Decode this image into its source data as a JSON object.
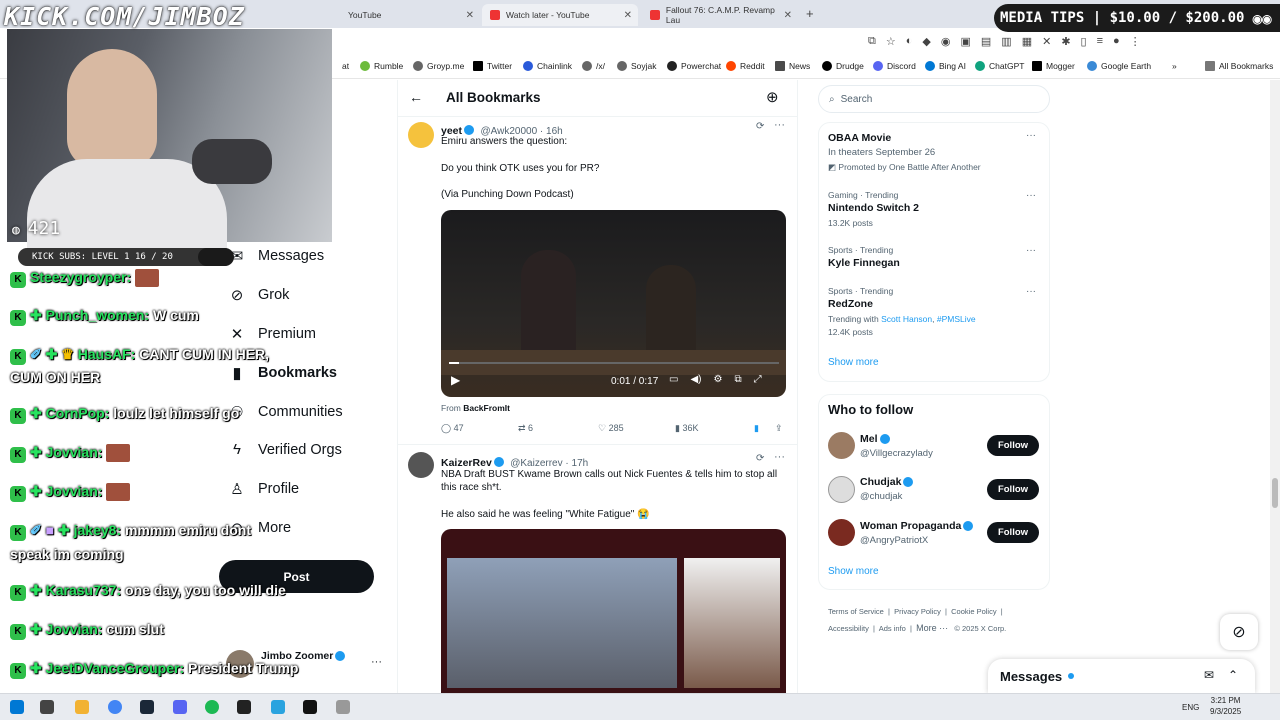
{
  "overlay": {
    "channel": "KICK.COM/JIMBOZ",
    "media_tips": "MEDIA TIPS | $10.00 / $200.00",
    "viewers": "421",
    "subs": "KICK SUBS: LEVEL 1 16 / 20"
  },
  "tabs": [
    {
      "label": "YouTube"
    },
    {
      "label": "Watch later - YouTube"
    },
    {
      "label": "Fallout 76: C.A.M.P. Revamp Lau"
    }
  ],
  "bookmarks": [
    "Rumble",
    "Groyp.me",
    "Twitter",
    "Chainlink",
    "/x/",
    "Soyjak",
    "Powerchat",
    "Reddit",
    "News",
    "Drudge",
    "Discord",
    "Bing AI",
    "ChatGPT",
    "Mogger",
    "Google Earth",
    "All Bookmarks"
  ],
  "chat": [
    {
      "user": "Steezygroyper:",
      "msg": ""
    },
    {
      "user": "Punch_women:",
      "msg": "W cum"
    },
    {
      "user": "HausAF:",
      "msg": "CANT CUM IN HER,"
    },
    {
      "user": "",
      "msg": "CUM ON HER"
    },
    {
      "user": "CornPop:",
      "msg": "loulz let himself go"
    },
    {
      "user": "Jovvian:",
      "msg": ""
    },
    {
      "user": "Jovvian:",
      "msg": ""
    },
    {
      "user": "jakey8:",
      "msg": "mmmm emiru dont"
    },
    {
      "user": "",
      "msg": "speak im coming"
    },
    {
      "user": "Karasu737:",
      "msg": "one day, you too will die"
    },
    {
      "user": "Jovvian:",
      "msg": "cum slut"
    },
    {
      "user": "JeetDVanceGrouper:",
      "msg": "President Trump"
    }
  ],
  "nav": {
    "messages": "Messages",
    "grok": "Grok",
    "premium": "Premium",
    "bookmarks": "Bookmarks",
    "communities": "Communities",
    "verified": "Verified Orgs",
    "profile": "Profile",
    "more": "More",
    "post": "Post",
    "account_name": "Jimbo Zoomer"
  },
  "feed": {
    "title": "All Bookmarks",
    "t1": {
      "name": "yeet",
      "handle": "@Awk20000",
      "time": "16h",
      "line1": "Emiru answers the question:",
      "line2": "Do you think OTK uses you for PR?",
      "line3": "(Via Punching Down Podcast)",
      "video_time": "0:01 / 0:17",
      "from_label": "From",
      "from": "BackFromIt",
      "replies": "47",
      "reposts": "6",
      "likes": "285",
      "views": "36K"
    },
    "t2": {
      "name": "KaizerRev",
      "handle": "@Kaizerrev",
      "time": "17h",
      "line1": "NBA Draft BUST Kwame Brown calls out Nick Fuentes & tells him to stop all",
      "line2": "this race sh*t.",
      "line3": "He also said he was feeling \"White Fatigue\" 😭"
    }
  },
  "side": {
    "search": "Search",
    "promo": {
      "name": "OBAA Movie",
      "sub": "In theaters September 26",
      "promo": "Promoted by One Battle After Another"
    },
    "trends": [
      {
        "cat": "Gaming · Trending",
        "name": "Nintendo Switch 2",
        "count": "13.2K posts"
      },
      {
        "cat": "Sports · Trending",
        "name": "Kyle Finnegan",
        "count": ""
      },
      {
        "cat": "Sports · Trending",
        "name": "RedZone",
        "count": "12.4K posts",
        "with": "Trending with",
        "w1": "Scott Hanson",
        "w2": "#PMSLive"
      }
    ],
    "show_more": "Show more",
    "wtf_title": "Who to follow",
    "follows": [
      {
        "name": "Mel",
        "handle": "@Villgecrazylady"
      },
      {
        "name": "Chudjak",
        "handle": "@chudjak"
      },
      {
        "name": "Woman Propaganda",
        "handle": "@AngryPatriotX"
      }
    ],
    "follow_label": "Follow",
    "show_more2": "Show more",
    "footer": [
      "Terms of Service",
      "Privacy Policy",
      "Cookie Policy",
      "Accessibility",
      "Ads info",
      "More ···",
      "© 2025 X Corp."
    ],
    "messages_dock": "Messages"
  },
  "taskbar": {
    "lang": "ENG",
    "time": "3:21 PM",
    "date": "9/3/2025"
  }
}
